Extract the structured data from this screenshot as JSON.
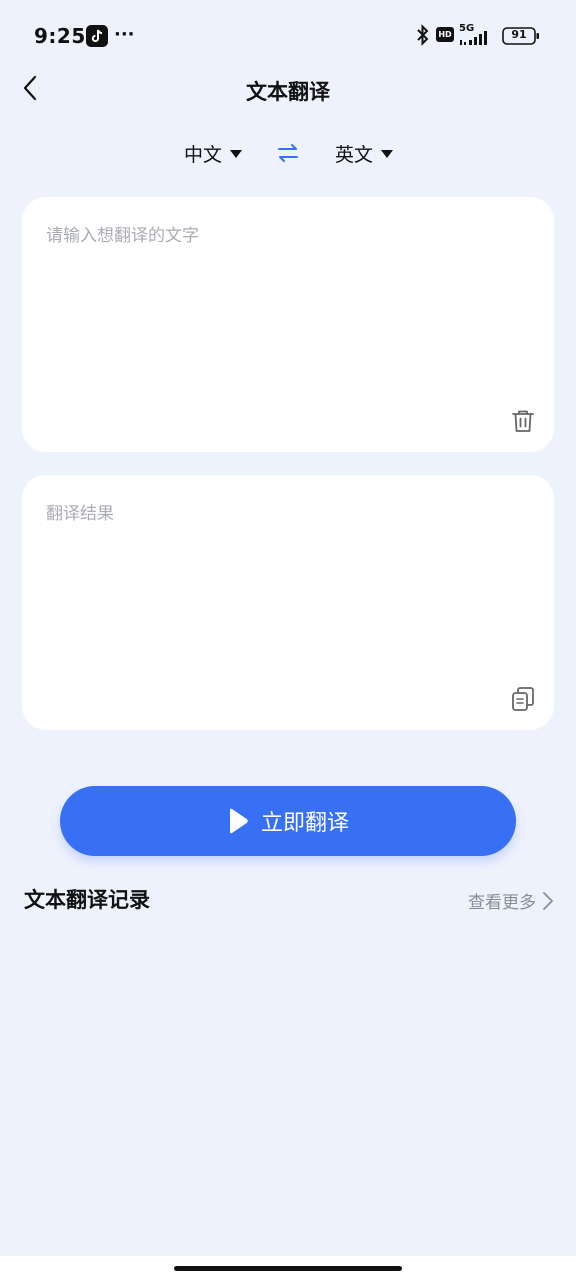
{
  "status_bar": {
    "time": "9:25",
    "more": "···",
    "battery": "91",
    "network": "5G",
    "hd": "HD"
  },
  "nav": {
    "title": "文本翻译"
  },
  "languages": {
    "source": "中文",
    "target": "英文"
  },
  "input_card": {
    "placeholder": "请输入想翻译的文字"
  },
  "result_card": {
    "placeholder": "翻译结果"
  },
  "actions": {
    "translate_label": "立即翻译"
  },
  "history": {
    "title": "文本翻译记录",
    "more_label": "查看更多"
  },
  "colors": {
    "accent": "#3770f4",
    "background": "#eef2fc",
    "card": "#ffffff",
    "placeholder": "#a9acb3"
  }
}
